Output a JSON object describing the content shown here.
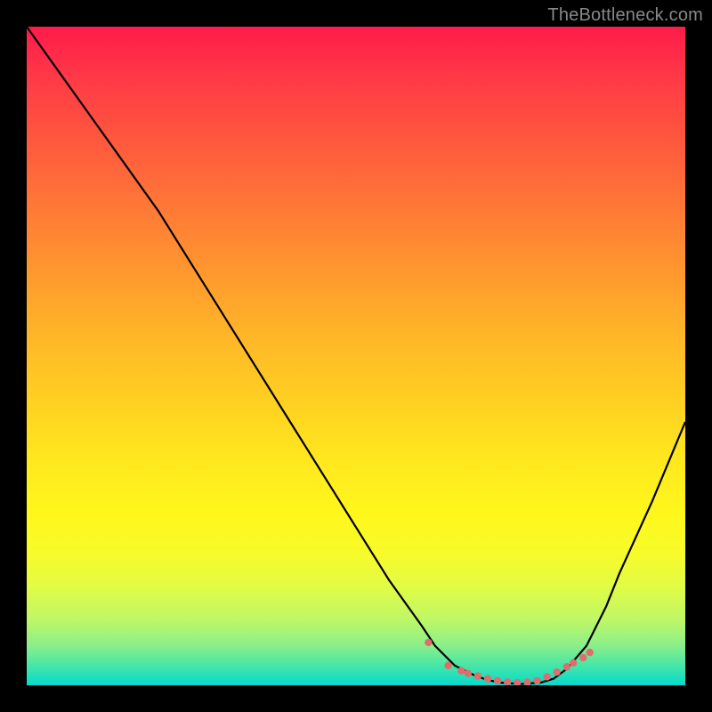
{
  "watermark": "TheBottleneck.com",
  "chart_data": {
    "type": "line",
    "title": "",
    "xlabel": "",
    "ylabel": "",
    "xlim": [
      0,
      100
    ],
    "ylim": [
      0,
      100
    ],
    "x": [
      0,
      5,
      10,
      15,
      20,
      25,
      30,
      35,
      40,
      45,
      50,
      55,
      60,
      62,
      65,
      68,
      70,
      72,
      75,
      78,
      80,
      82,
      85,
      88,
      90,
      95,
      100
    ],
    "values": [
      100,
      93,
      86,
      79,
      72,
      64,
      56,
      48,
      40,
      32,
      24,
      16,
      9,
      6,
      3,
      1.5,
      0.8,
      0.4,
      0.2,
      0.4,
      1,
      2.5,
      6,
      12,
      17,
      28,
      40
    ],
    "annotations": {
      "dotted_cluster_x": [
        61,
        64,
        66,
        67,
        68.5,
        70,
        71.5,
        73,
        74.5,
        76,
        77.5,
        79,
        80.5,
        82,
        83,
        84.5,
        85.5
      ],
      "dotted_cluster_y": [
        6.5,
        3.0,
        2.2,
        1.8,
        1.4,
        1.0,
        0.7,
        0.5,
        0.4,
        0.5,
        0.7,
        1.3,
        2.0,
        2.8,
        3.4,
        4.2,
        5.0
      ]
    }
  }
}
